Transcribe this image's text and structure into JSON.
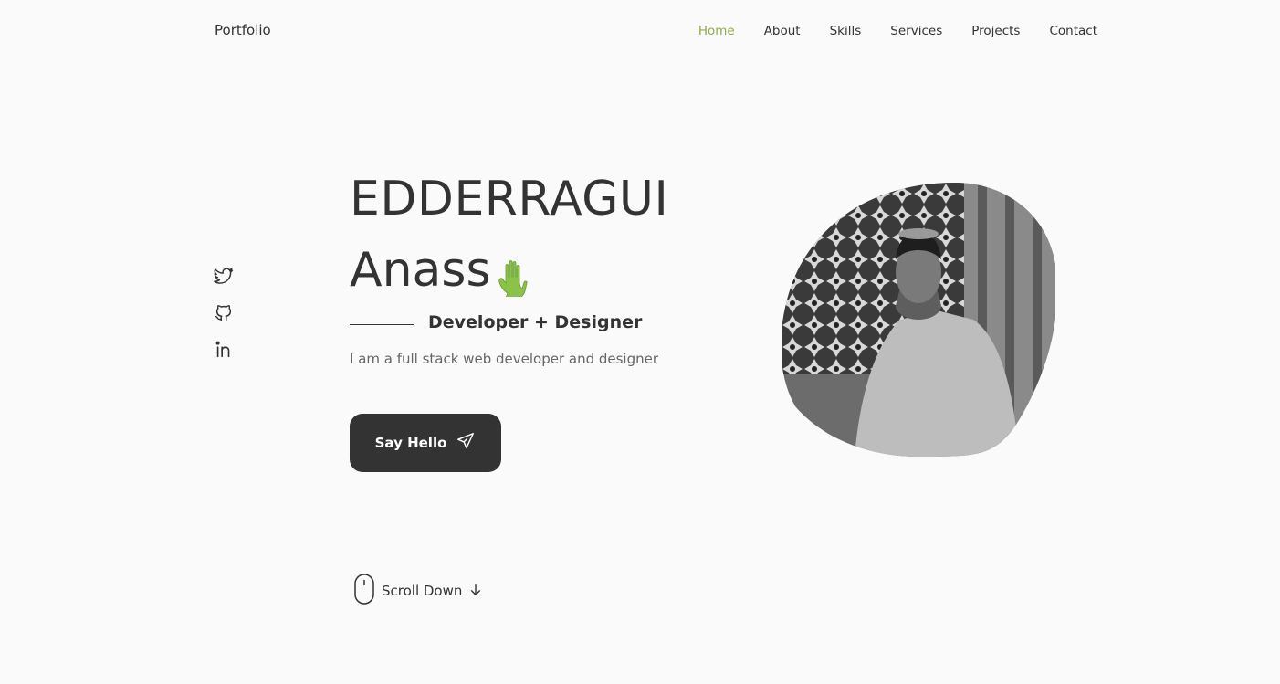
{
  "header": {
    "logo": "Portfolio",
    "nav": [
      "Home",
      "About",
      "Skills",
      "Services",
      "Projects",
      "Contact"
    ],
    "active": "Home",
    "accent_color": "#8bad4a"
  },
  "socials": [
    {
      "name": "twitter-icon"
    },
    {
      "name": "github-icon"
    },
    {
      "name": "linkedin-icon"
    }
  ],
  "hero": {
    "title_line1": "EDDERRAGUI",
    "title_line2": "Anass",
    "hand_icon": "waving-hand-icon",
    "subtitle": "Developer + Designer",
    "description": "I am a full stack web developer and designer",
    "button_label": "Say Hello",
    "button_icon": "send-icon"
  },
  "scroll": {
    "label": "Scroll Down",
    "mouse_icon": "mouse-icon",
    "arrow_icon": "arrow-down-icon"
  },
  "colors": {
    "background": "#fafafa",
    "text": "#333333",
    "button": "#333333",
    "hand": "#8bc34a"
  }
}
